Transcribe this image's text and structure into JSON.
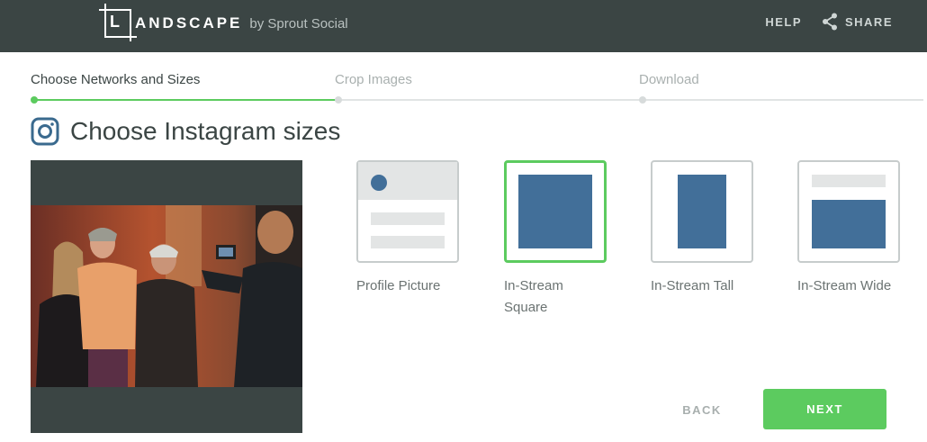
{
  "header": {
    "logo_letter": "L",
    "logo_text": "ANDSCAPE",
    "logo_by": "by Sprout Social",
    "help_label": "HELP",
    "share_label": "SHARE"
  },
  "steps": [
    {
      "label": "Choose Networks and Sizes",
      "active": true
    },
    {
      "label": "Crop Images",
      "active": false
    },
    {
      "label": "Download",
      "active": false
    }
  ],
  "page_title": "Choose Instagram sizes",
  "options": [
    {
      "label": "Profile Picture",
      "selected": false,
      "icon": "profile-picture-layout-icon"
    },
    {
      "label": "In-Stream Square",
      "selected": true,
      "icon": "square-layout-icon"
    },
    {
      "label": "In-Stream Tall",
      "selected": false,
      "icon": "tall-layout-icon"
    },
    {
      "label": "In-Stream Wide",
      "selected": false,
      "icon": "wide-layout-icon"
    }
  ],
  "buttons": {
    "back": "BACK",
    "next": "NEXT"
  },
  "colors": {
    "header_bg": "#3b4544",
    "accent_green": "#5ccb5f",
    "layout_blue": "#426f99"
  }
}
